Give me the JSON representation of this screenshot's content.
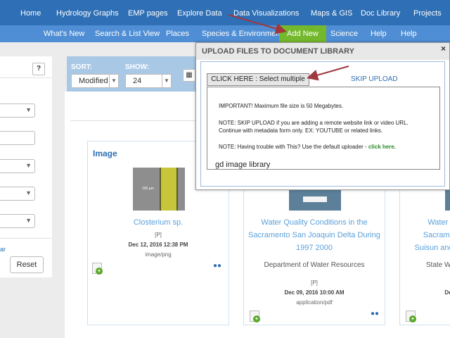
{
  "nav_top": [
    "Home",
    "Hydrology Graphs",
    "EMP pages",
    "Explore Data",
    "Data Visualizations",
    "Maps & GIS",
    "Doc Library",
    "Projects"
  ],
  "nav_second": [
    "What's New",
    "Search & List View",
    "Places",
    "Species & Environment",
    "Add New",
    "Science",
    "Help",
    "Help"
  ],
  "left_panel": {
    "help_label": "?",
    "reset_label": "Reset",
    "partial_link": "ar"
  },
  "sort_bar": {
    "sort_label": "SORT:",
    "show_label": "SHOW:",
    "sort_value": "Modified",
    "show_value": "24"
  },
  "cards": [
    {
      "heading": "Image",
      "title": "Closterium sp.",
      "access": "[P]",
      "date": "Dec 12, 2016 12:38 PM",
      "mime": "image/png",
      "thumb_caption": "100 µm"
    },
    {
      "title_lines": [
        "Water Quality Conditions in the",
        "Sacramento San Joaquin Delta During",
        "1997 2000"
      ],
      "org": "Department of Water Resources",
      "access": "[P]",
      "date": "Dec 09, 2016 10:00 AM",
      "mime": "application/pdf"
    },
    {
      "title_lines": [
        "Water Qu",
        "Sacrament",
        "Suisun and S"
      ],
      "org": "State Wate",
      "date": "Dec"
    }
  ],
  "modal": {
    "title": "UPLOAD FILES TO DOCUMENT LIBRARY",
    "close": "×",
    "multi_button": "CLICK HERE : Select multiple files.",
    "skip_upload": "SKIP UPLOAD",
    "note1": "IMPORTANT! Maximum file size is 50 Megabytes.",
    "note2_line1": "NOTE: SKIP UPLOAD if you are adding a remote website link or video URL.",
    "note2_line2": "Continue with metadata form only. EX: YOUTUBE or related links.",
    "note3": "NOTE: Having trouble with This? Use the default uploader - ",
    "note3_link": "click here.",
    "library_name": "gd image library"
  },
  "colors": {
    "nav_top": "#2e6fb5",
    "nav_second": "#4f8ed4",
    "add_new": "#74b92d",
    "arrow": "#a0393f"
  }
}
